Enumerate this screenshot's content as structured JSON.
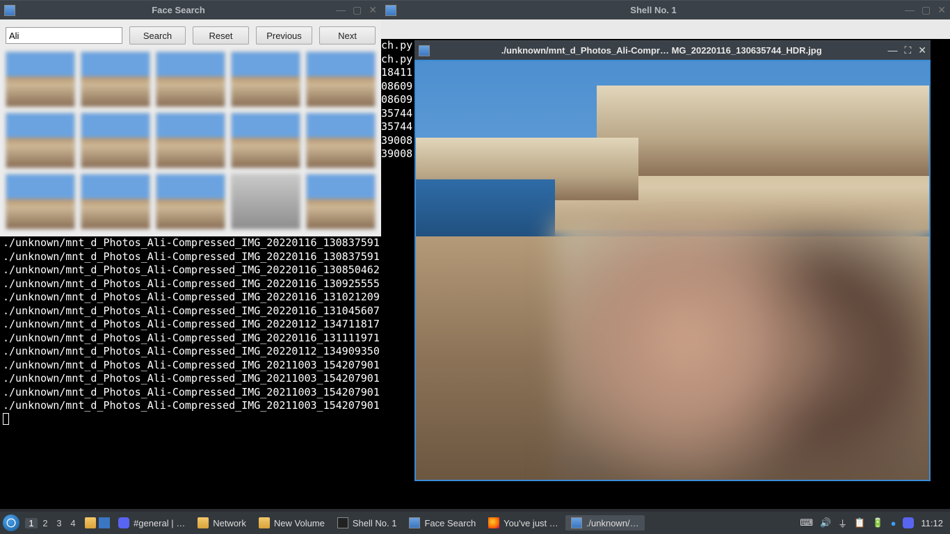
{
  "faceSearch": {
    "title": "Face Search",
    "searchValue": "Ali",
    "buttons": {
      "search": "Search",
      "reset": "Reset",
      "previous": "Previous",
      "next": "Next"
    }
  },
  "shell": {
    "title": "Shell No. 1"
  },
  "imageViewer": {
    "title": "./unknown/mnt_d_Photos_Ali-Compr… MG_20220116_130635744_HDR.jpg"
  },
  "rightFragments": [
    "ch.py",
    "",
    "",
    "",
    "ch.py",
    "",
    "18411",
    "08609",
    "08609",
    "35744",
    "35744",
    "39008",
    "39008"
  ],
  "termLines": [
    "./unknown/mnt_d_Photos_Ali-Compressed_IMG_20220116_130837591",
    "./unknown/mnt_d_Photos_Ali-Compressed_IMG_20220116_130837591",
    "./unknown/mnt_d_Photos_Ali-Compressed_IMG_20220116_130850462",
    "./unknown/mnt_d_Photos_Ali-Compressed_IMG_20220116_130925555",
    "./unknown/mnt_d_Photos_Ali-Compressed_IMG_20220116_131021209",
    "./unknown/mnt_d_Photos_Ali-Compressed_IMG_20220116_131045607",
    "./unknown/mnt_d_Photos_Ali-Compressed_IMG_20220112_134711817",
    "./unknown/mnt_d_Photos_Ali-Compressed_IMG_20220116_131111971",
    "./unknown/mnt_d_Photos_Ali-Compressed_IMG_20220112_134909350",
    "./unknown/mnt_d_Photos_Ali-Compressed_IMG_20211003_154207901",
    "./unknown/mnt_d_Photos_Ali-Compressed_IMG_20211003_154207901",
    "./unknown/mnt_d_Photos_Ali-Compressed_IMG_20211003_154207901",
    "./unknown/mnt_d_Photos_Ali-Compressed_IMG_20211003_154207901"
  ],
  "taskbar": {
    "workspaces": [
      "1",
      "2",
      "3",
      "4"
    ],
    "activeWorkspace": 0,
    "items": [
      {
        "label": "#general | …",
        "icon": "discord"
      },
      {
        "label": "Network",
        "icon": "folder"
      },
      {
        "label": "New Volume",
        "icon": "folder"
      },
      {
        "label": "Shell No. 1",
        "icon": "term"
      },
      {
        "label": "Face Search",
        "icon": "win"
      },
      {
        "label": "You've just …",
        "icon": "ff"
      },
      {
        "label": "./unknown/…",
        "icon": "win",
        "active": true
      }
    ],
    "clock": "11:12"
  }
}
